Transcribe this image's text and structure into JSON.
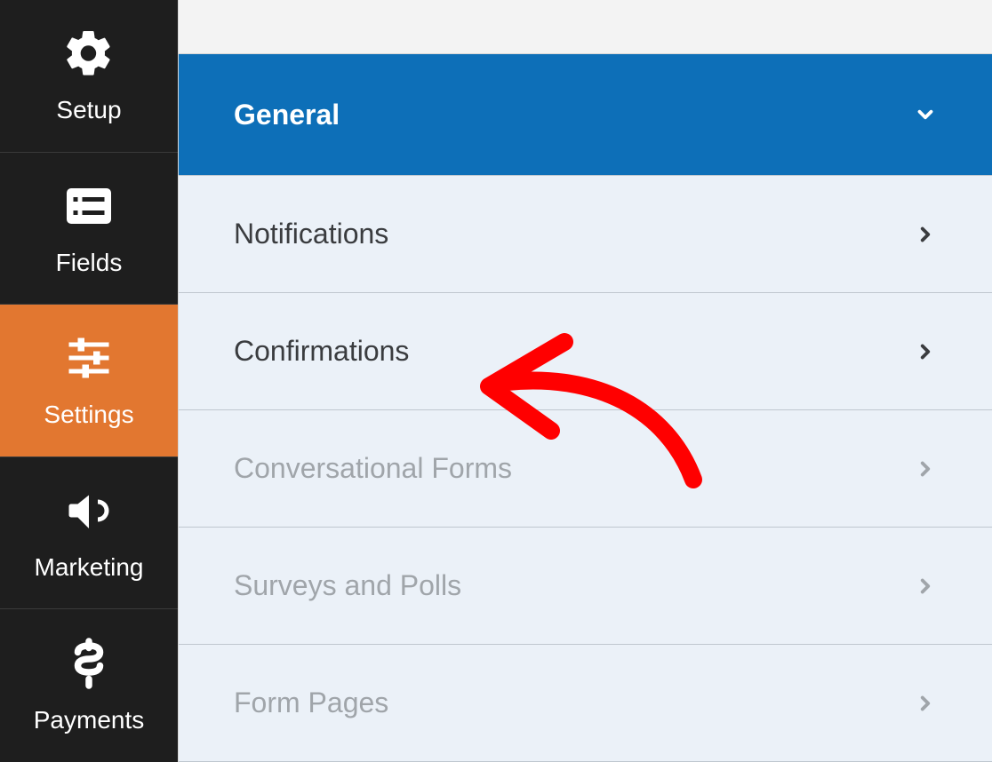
{
  "sidebar": {
    "items": [
      {
        "label": "Setup"
      },
      {
        "label": "Fields"
      },
      {
        "label": "Settings"
      },
      {
        "label": "Marketing"
      },
      {
        "label": "Payments"
      }
    ]
  },
  "settings": {
    "header": {
      "label": "General"
    },
    "items": [
      {
        "label": "Notifications",
        "dimmed": false
      },
      {
        "label": "Confirmations",
        "dimmed": false
      },
      {
        "label": "Conversational Forms",
        "dimmed": true
      },
      {
        "label": "Surveys and Polls",
        "dimmed": true
      },
      {
        "label": "Form Pages",
        "dimmed": true
      }
    ]
  }
}
